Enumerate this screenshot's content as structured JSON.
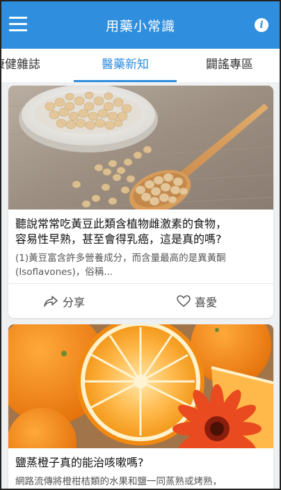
{
  "app": {
    "title": "用藥小常識"
  },
  "tabs": [
    {
      "label": "康健雜誌"
    },
    {
      "label": "醫藥新知"
    },
    {
      "label": "闢謠專區"
    }
  ],
  "active_tab_color": "#2f8ede",
  "icons": {
    "menu": "hamburger-menu-icon",
    "info": "info-icon",
    "share": "share-arrow-icon",
    "like": "heart-outline-icon"
  },
  "articles": [
    {
      "headline_line1": "聽說常常吃黃豆此類含植物雌激素的食物，",
      "headline_line2": "容易性早熟，甚至會得乳癌，這是真的嗎?",
      "snippet_line1": "(1)黃豆富含許多營養成分，而含量最高的是異黃酮",
      "snippet_line2": "(Isoflavones)，俗稱...",
      "share_label": "分享",
      "like_label": "喜愛"
    },
    {
      "headline_line1": "鹽蒸橙子真的能治咳嗽嗎?",
      "snippet_line1": "網路流傳將橙柑桔類的水果和鹽一同蒸熟或烤熟，"
    }
  ]
}
